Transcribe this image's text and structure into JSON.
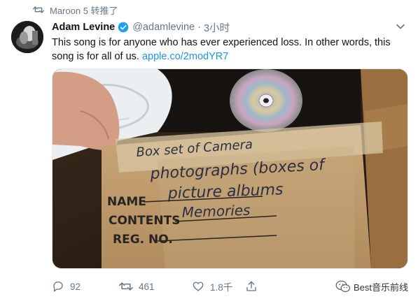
{
  "retweet_note": {
    "icon": "retweet-icon",
    "text": "Maroon 5 转推了"
  },
  "tweet": {
    "author_name": "Adam Levine",
    "verified": true,
    "handle": "@adamlevine",
    "separator": "·",
    "time": "3小时",
    "text": "This song is for anyone who has ever experienced loss. In other words, this song is for all of us.",
    "link": "apple.co/2modYR7",
    "image": {
      "handwriting_line1": "Box set of Camera",
      "handwriting_line2": "photographs (boxes of",
      "handwriting_line3": "picture albums",
      "handwriting_line4": "Memories",
      "label_name": "NAME",
      "label_contents": "CONTENTS",
      "label_reg": "REG. NO."
    }
  },
  "actions": {
    "reply_count": "92",
    "retweet_count": "461",
    "like_count": "1.8千"
  },
  "watermark": {
    "text": "Best音乐前线"
  },
  "colors": {
    "link": "#1b95e0",
    "muted": "#657786",
    "verified": "#1da1f2",
    "text": "#0f1419"
  }
}
